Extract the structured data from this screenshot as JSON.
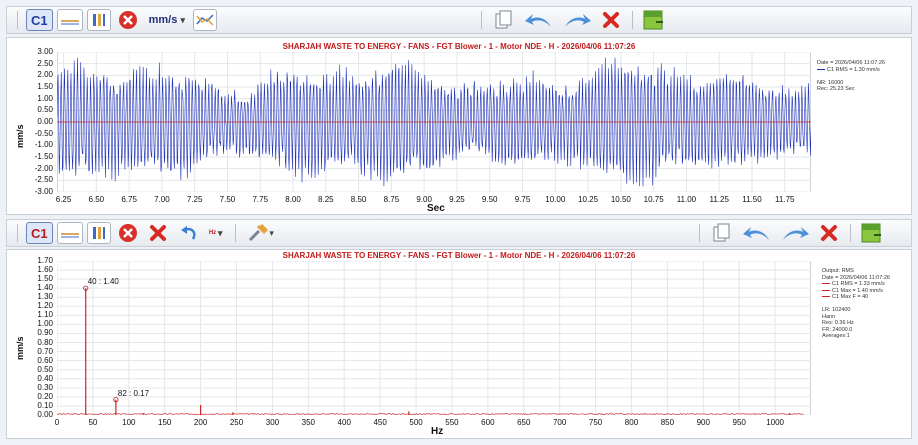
{
  "toolbar_top": {
    "channel_label": "C1",
    "unit_label": "mm/s",
    "unit_dropdown_arrow": "▾"
  },
  "toolbar_bottom": {
    "channel_label": "C1",
    "unit_label": "Hz",
    "unit_dropdown_arrow": "▾",
    "tools_dropdown_arrow": "▾"
  },
  "waveform": {
    "title": "SHARJAH WASTE TO ENERGY - FANS - FGT Blower - 1 - Motor NDE - H - 2026/04/06 11:07:26",
    "legend": [
      "Date = 2026/04/06 11:07:26",
      "C1 RMS = 1.30 mm/s",
      "",
      "NR: 16000",
      "Rec: 25.23 Sec"
    ],
    "xlabel": "Sec",
    "ylabel": "mm/s",
    "series_color": "#1c2fb8",
    "zero_line_color": "#cc2a2a"
  },
  "spectrum": {
    "title": "SHARJAH WASTE TO ENERGY - FANS - FGT Blower - 1 - Motor NDE - H - 2026/04/06 11:07:26",
    "legend": [
      "Output: RMS",
      "Date = 2026/04/06 11:07:26",
      "C1 RMS = 1.33 mm/s",
      "C1 Max = 1.40 mm/s",
      "C1 Max F = 40",
      "",
      "LR: 102400",
      "Hann",
      "Res: 0.36 Hz",
      "FR: 24000.0",
      "Averages:1"
    ],
    "xlabel": "Hz",
    "ylabel": "mm/s",
    "series_color": "#d42020",
    "peak_annotations": [
      "40 : 1.40",
      "82 : 0.17"
    ]
  },
  "chart_data": [
    {
      "type": "line",
      "title": "SHARJAH WASTE TO ENERGY - FANS - FGT Blower - 1 - Motor NDE - H - 2026/04/06 11:07:26",
      "xlabel": "Sec",
      "ylabel": "mm/s",
      "xlim": [
        6.2,
        11.95
      ],
      "ylim": [
        -3.0,
        3.0
      ],
      "x_ticks": [
        "6.25",
        "6.50",
        "6.75",
        "7.00",
        "7.25",
        "7.50",
        "7.75",
        "8.00",
        "8.25",
        "8.50",
        "8.75",
        "9.00",
        "9.25",
        "9.50",
        "9.75",
        "10.00",
        "10.25",
        "10.50",
        "10.75",
        "11.00",
        "11.25",
        "11.50",
        "11.75"
      ],
      "y_ticks": [
        "3.00",
        "2.50",
        "2.00",
        "1.50",
        "1.00",
        "0.50",
        "0.00",
        "-0.50",
        "-1.00",
        "-1.50",
        "-2.00",
        "-2.50",
        "-3.00"
      ],
      "grid": true,
      "series": [
        {
          "name": "C1",
          "rms": 1.3,
          "peak_approx": 2.7
        }
      ]
    },
    {
      "type": "line",
      "title": "SHARJAH WASTE TO ENERGY - FANS - FGT Blower - 1 - Motor NDE - H - 2026/04/06 11:07:26",
      "xlabel": "Hz",
      "ylabel": "mm/s",
      "xlim": [
        0,
        1050
      ],
      "ylim": [
        0,
        1.7
      ],
      "x_ticks": [
        "0",
        "50",
        "100",
        "150",
        "200",
        "250",
        "300",
        "350",
        "400",
        "450",
        "500",
        "550",
        "600",
        "650",
        "700",
        "750",
        "800",
        "850",
        "900",
        "950",
        "1000"
      ],
      "y_ticks": [
        "1.70",
        "1.60",
        "1.50",
        "1.40",
        "1.30",
        "1.20",
        "1.10",
        "1.00",
        "0.90",
        "0.80",
        "0.70",
        "0.60",
        "0.50",
        "0.40",
        "0.30",
        "0.20",
        "0.10",
        "0.00"
      ],
      "grid": true,
      "series": [
        {
          "name": "C1",
          "x": [
            40,
            82,
            200,
            120,
            245,
            490,
            1020
          ],
          "y": [
            1.4,
            0.17,
            0.11,
            0.02,
            0.03,
            0.04,
            0.02
          ]
        }
      ]
    }
  ]
}
